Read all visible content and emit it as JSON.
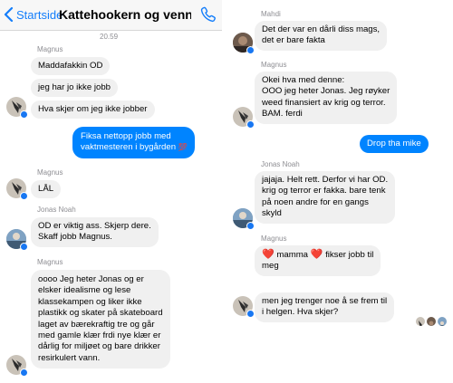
{
  "header": {
    "back_label": "Startside",
    "title": "Kattehookern og vennen...",
    "back_icon": "chevron-left-icon",
    "call_icon": "phone-icon"
  },
  "left": {
    "timestamp": "20.59",
    "messages": [
      {
        "sender": "Magnus"
      },
      {
        "text": "Maddafakkin OD"
      },
      {
        "text": "jeg har jo ikke jobb"
      },
      {
        "text": "Hva skjer om jeg ikke jobber"
      },
      {
        "lines": [
          "Fiksa nettopp jobb med",
          "vaktmesteren i bygården"
        ],
        "emoji": "💯"
      },
      {
        "sender": "Magnus"
      },
      {
        "text": "LÅL"
      },
      {
        "sender": "Jonas Noah"
      },
      {
        "lines": [
          "OD er viktig ass. Skjerp dere.",
          "Skaff jobb Magnus."
        ]
      },
      {
        "sender": "Magnus"
      },
      {
        "lines": [
          "oooo Jeg heter Jonas og er",
          "elsker idealisme og lese",
          "klassekampen og liker ikke",
          "plastikk og skater på skateboard",
          "laget av bærekraftig tre og går",
          "med gamle klær frdi nye klær er",
          "dårlig for miljøet og bare drikker",
          "resirkulert vann."
        ]
      }
    ]
  },
  "right": {
    "messages": [
      {
        "sender": "Mahdi"
      },
      {
        "lines": [
          "Det der var en dårli diss mags,",
          "det er bare fakta"
        ]
      },
      {
        "sender": "Magnus"
      },
      {
        "lines": [
          "Okei hva med denne:",
          "OOO jeg heter Jonas. Jeg røyker",
          "weed finansiert av krig og terror.",
          "BAM. ferdi"
        ]
      },
      {
        "text": "Drop tha mike"
      },
      {
        "sender": "Jonas Noah"
      },
      {
        "lines": [
          "jajaja. Helt rett. Derfor vi har OD.",
          "krig og terror er fakka. bare tenk",
          "på noen andre for en gangs",
          "skyld"
        ]
      },
      {
        "sender": "Magnus"
      },
      {
        "line1": [
          "mamma",
          "fikser jobb til"
        ],
        "line2": "meg",
        "emoji": "❤️"
      },
      {
        "lines": [
          "men jeg trenger noe å se frem til",
          "i helgen. Hva skjer?"
        ]
      }
    ]
  },
  "colors": {
    "accent": "#147efb",
    "outgoing_bubble": "#0084ff",
    "incoming_bubble": "#f0f0f0",
    "meta_text": "#8e8e93",
    "messenger_badge": "#1877f2"
  }
}
